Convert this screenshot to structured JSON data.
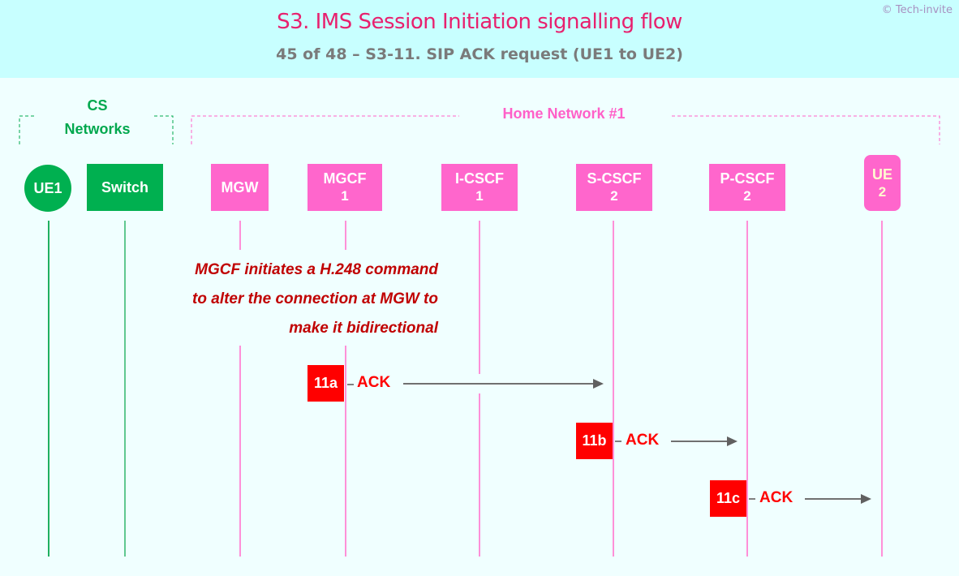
{
  "header": {
    "title": "S3. IMS Session Initiation signalling flow",
    "subtitle": "45 of 48 – S3-11. SIP ACK request (UE1 to UE2)",
    "copyright": "© Tech-invite"
  },
  "groups": {
    "cs": {
      "line1": "CS",
      "line2": "Networks",
      "color": "#00a84e"
    },
    "home": {
      "label": "Home Network #1",
      "color": "#ff60c8"
    }
  },
  "nodes": [
    {
      "id": "ue1",
      "name": "UE1",
      "sub": ""
    },
    {
      "id": "switch",
      "name": "Switch",
      "sub": ""
    },
    {
      "id": "mgw",
      "name": "MGW",
      "sub": ""
    },
    {
      "id": "mgcf1",
      "name": "MGCF",
      "sub": "1"
    },
    {
      "id": "icscf1",
      "name": "I-CSCF",
      "sub": "1"
    },
    {
      "id": "scscf2",
      "name": "S-CSCF",
      "sub": "2"
    },
    {
      "id": "pcscf2",
      "name": "P-CSCF",
      "sub": "2"
    },
    {
      "id": "ue2",
      "name": "UE",
      "sub": "2"
    }
  ],
  "note": {
    "line1": "MGCF initiates a H.248 command",
    "line2": "to alter the connection at MGW to",
    "line3": "make it bidirectional"
  },
  "messages": [
    {
      "step": "11a",
      "label": "ACK",
      "from": "MGCF 1",
      "to": "S-CSCF 2"
    },
    {
      "step": "11b",
      "label": "ACK",
      "from": "S-CSCF 2",
      "to": "P-CSCF 2"
    },
    {
      "step": "11c",
      "label": "ACK",
      "from": "P-CSCF 2",
      "to": "UE 2"
    }
  ],
  "colors": {
    "title": "#e8206e",
    "cs_green": "#00b050",
    "ims_pink": "#ff66cc",
    "step_red": "#ff0000",
    "note_red": "#c00000"
  }
}
